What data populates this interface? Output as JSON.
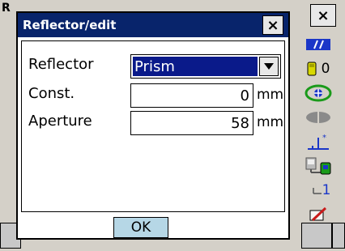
{
  "background": {
    "partial_title": "R"
  },
  "dialog": {
    "title": "Reflector/edit",
    "fields": [
      {
        "label": "Reflector",
        "value": "Prism",
        "type": "select"
      },
      {
        "label": "Const.",
        "value": "0",
        "unit": "mm"
      },
      {
        "label": "Aperture",
        "value": "58",
        "unit": "mm"
      }
    ],
    "ok_label": "OK"
  },
  "status": {
    "count": "0",
    "channel": "1"
  },
  "colors": {
    "titlebar": "#08246b",
    "selection": "#0a1a8a",
    "ok_button": "#b6d7e6"
  }
}
